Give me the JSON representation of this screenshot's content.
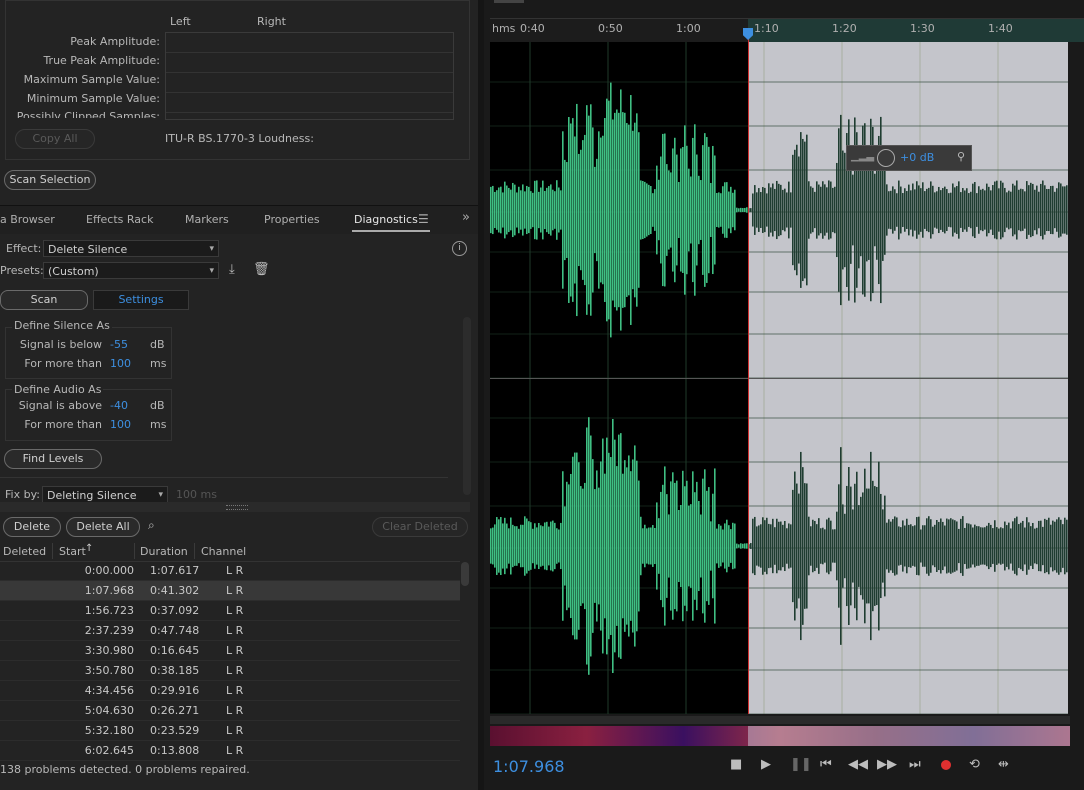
{
  "amplitude_stats": {
    "col_left": "Left",
    "col_right": "Right",
    "rows": [
      "Peak Amplitude:",
      "True Peak Amplitude:",
      "Maximum Sample Value:",
      "Minimum Sample Value:",
      "Possibly Clipped Samples:"
    ],
    "copy_all": "Copy All",
    "loudness_label": "ITU-R BS.1770-3 Loudness:",
    "scan_selection": "Scan Selection"
  },
  "tabs": [
    {
      "label": "a Browser"
    },
    {
      "label": "Effects Rack"
    },
    {
      "label": "Markers"
    },
    {
      "label": "Properties"
    },
    {
      "label": "Diagnostics"
    }
  ],
  "diagnostics": {
    "effect_label": "Effect:",
    "effect_value": "Delete Silence",
    "presets_label": "Presets:",
    "presets_value": "(Custom)",
    "scan_tab": "Scan",
    "settings_tab": "Settings",
    "silence_group": "Define Silence As",
    "silence_signal_label": "Signal is below",
    "silence_signal_value": "-55",
    "silence_signal_unit": "dB",
    "silence_time_label": "For more than",
    "silence_time_value": "100",
    "silence_time_unit": "ms",
    "audio_group": "Define Audio As",
    "audio_signal_label": "Signal is above",
    "audio_signal_value": "-40",
    "audio_signal_unit": "dB",
    "audio_time_label": "For more than",
    "audio_time_value": "100",
    "audio_time_unit": "ms",
    "find_levels": "Find Levels",
    "fix_by_label": "Fix by:",
    "fix_by_value": "Deleting Silence",
    "fix_by_extra": "100 ms",
    "delete_btn": "Delete",
    "delete_all_btn": "Delete All",
    "clear_deleted_btn": "Clear Deleted"
  },
  "results": {
    "columns": [
      "Deleted",
      "Start",
      "Duration",
      "Channel"
    ],
    "rows": [
      {
        "start": "0:00.000",
        "duration": "1:07.617",
        "channel": "L R"
      },
      {
        "start": "1:07.968",
        "duration": "0:41.302",
        "channel": "L R"
      },
      {
        "start": "1:56.723",
        "duration": "0:37.092",
        "channel": "L R"
      },
      {
        "start": "2:37.239",
        "duration": "0:47.748",
        "channel": "L R"
      },
      {
        "start": "3:30.980",
        "duration": "0:16.645",
        "channel": "L R"
      },
      {
        "start": "3:50.780",
        "duration": "0:38.185",
        "channel": "L R"
      },
      {
        "start": "4:34.456",
        "duration": "0:29.916",
        "channel": "L R"
      },
      {
        "start": "5:04.630",
        "duration": "0:26.271",
        "channel": "L R"
      },
      {
        "start": "5:32.180",
        "duration": "0:23.529",
        "channel": "L R"
      },
      {
        "start": "6:02.645",
        "duration": "0:13.808",
        "channel": "L R"
      }
    ],
    "status": "138 problems detected. 0 problems repaired."
  },
  "editor": {
    "ruler_unit": "hms",
    "ruler_ticks": [
      "0:40",
      "0:50",
      "1:00",
      "1:10",
      "1:20",
      "1:30",
      "1:40"
    ],
    "hud_gain": "+0 dB",
    "current_time": "1:07.968"
  },
  "colors": {
    "waveform": "#3fbf83",
    "waveform_selected": "#1f3d31",
    "selection_bg": "#c4c5cb",
    "accent_blue": "#3d8fe0",
    "record_red": "#e03030"
  }
}
